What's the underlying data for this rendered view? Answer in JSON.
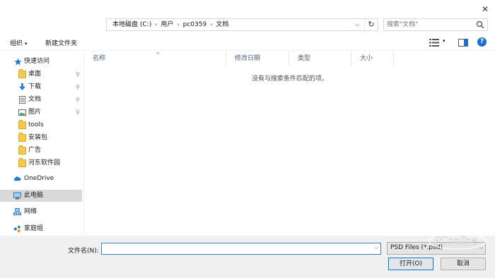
{
  "window": {
    "close_glyph": "✕"
  },
  "address": {
    "crumbs": [
      "本地磁盘 (C:)",
      "用户",
      "pc0359",
      "文档"
    ],
    "separator": "›",
    "dropdown_glyph": "⌵",
    "refresh_glyph": "↻"
  },
  "search": {
    "placeholder": "搜索\"文档\"",
    "icon": "search-icon"
  },
  "toolbar": {
    "organize_label": "组织",
    "organize_caret": "▾",
    "new_folder_label": "新建文件夹",
    "view_caret": "▾",
    "help_glyph": "?"
  },
  "nav": {
    "items": [
      {
        "label": "快速访问",
        "icon": "star-icon",
        "pinned": false
      },
      {
        "label": "桌面",
        "icon": "folder-icon",
        "pinned": true
      },
      {
        "label": "下载",
        "icon": "download-icon",
        "pinned": true
      },
      {
        "label": "文档",
        "icon": "document-icon",
        "pinned": true
      },
      {
        "label": "图片",
        "icon": "pictures-icon",
        "pinned": true
      },
      {
        "label": "tools",
        "icon": "folder-icon",
        "pinned": false
      },
      {
        "label": "安装包",
        "icon": "folder-icon",
        "pinned": false
      },
      {
        "label": "广告",
        "icon": "folder-icon",
        "pinned": false
      },
      {
        "label": "河东软件园",
        "icon": "folder-icon",
        "pinned": false
      },
      {
        "label": "OneDrive",
        "icon": "cloud-icon",
        "pinned": false
      },
      {
        "label": "此电脑",
        "icon": "computer-icon",
        "pinned": false,
        "selected": true
      },
      {
        "label": "网络",
        "icon": "network-icon",
        "pinned": false
      },
      {
        "label": "家庭组",
        "icon": "homegroup-icon",
        "pinned": false
      }
    ],
    "pin_glyph": "📌"
  },
  "columns": {
    "headers": [
      "名称",
      "修改日期",
      "类型",
      "大小"
    ],
    "sort_glyph": "^"
  },
  "content": {
    "empty_message": "没有与搜索条件匹配的项。"
  },
  "bottom": {
    "filename_label": "文件名(N):",
    "filename_value": "",
    "filetype_value": "PSD Files (*.psd)",
    "dropdown_glyph": "⌵",
    "open_label": "打开(O)",
    "cancel_label": "取消"
  },
  "watermark": {
    "text": "PConline"
  },
  "colors": {
    "accent": "#0078d7",
    "selected_bg": "#d9d9d9",
    "folder": "#f5c94b",
    "help": "#1a6fd0"
  }
}
